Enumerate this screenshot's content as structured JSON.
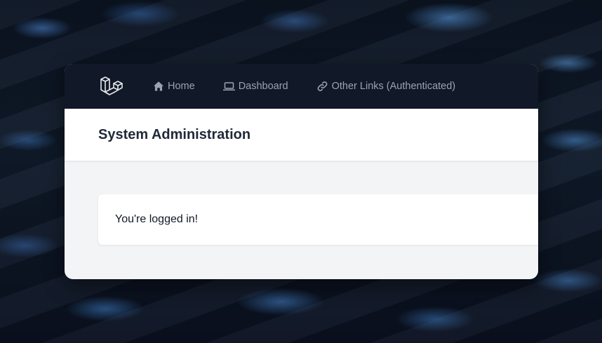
{
  "nav": {
    "logo_icon": "laravel-logo-icon",
    "items": [
      {
        "label": "Home",
        "icon": "home-icon"
      },
      {
        "label": "Dashboard",
        "icon": "laptop-icon"
      },
      {
        "label": "Other Links (Authenticated)",
        "icon": "link-icon"
      }
    ]
  },
  "header": {
    "title": "System Administration"
  },
  "main": {
    "message": "You're logged in!"
  },
  "colors": {
    "navbar_bg": "#111827",
    "nav_text": "#9ca3af",
    "header_bg": "#ffffff",
    "content_bg": "#f3f4f6",
    "title_text": "#1f2937"
  }
}
